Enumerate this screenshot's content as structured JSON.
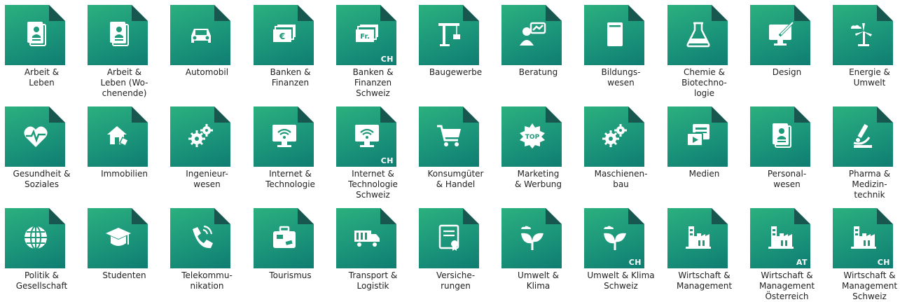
{
  "tiles": [
    {
      "label": "Arbeit &\nLeben",
      "icon": "id-card-icon",
      "cc": ""
    },
    {
      "label": "Arbeit &\nLeben (Wo-\nchenende)",
      "icon": "id-card-icon",
      "cc": ""
    },
    {
      "label": "Automobil",
      "icon": "car-icon",
      "cc": ""
    },
    {
      "label": "Banken &\nFinanzen",
      "icon": "euro-banknotes-icon",
      "cc": ""
    },
    {
      "label": "Banken &\nFinanzen\nSchweiz",
      "icon": "franc-banknotes-icon",
      "cc": "CH"
    },
    {
      "label": "Baugewerbe",
      "icon": "crane-icon",
      "cc": ""
    },
    {
      "label": "Beratung",
      "icon": "consultant-icon",
      "cc": ""
    },
    {
      "label": "Bildungs-\nwesen",
      "icon": "book-icon",
      "cc": ""
    },
    {
      "label": "Chemie &\nBiotechno-\nlogie",
      "icon": "flask-icon",
      "cc": ""
    },
    {
      "label": "Design",
      "icon": "monitor-brush-icon",
      "cc": ""
    },
    {
      "label": "Energie &\nUmwelt",
      "icon": "wind-turbine-icon",
      "cc": ""
    },
    {
      "label": "Gesundheit &\nSoziales",
      "icon": "heartbeat-icon",
      "cc": ""
    },
    {
      "label": "Immobilien",
      "icon": "house-tag-icon",
      "cc": ""
    },
    {
      "label": "Ingenieur-\nwesen",
      "icon": "gears-icon",
      "cc": ""
    },
    {
      "label": "Internet &\nTechnologie",
      "icon": "monitor-wifi-icon",
      "cc": ""
    },
    {
      "label": "Internet &\nTechnologie\nSchweiz",
      "icon": "monitor-wifi-icon",
      "cc": "CH"
    },
    {
      "label": "Konsumgüter\n& Handel",
      "icon": "shopping-cart-icon",
      "cc": ""
    },
    {
      "label": "Marketing\n& Werbung",
      "icon": "top-badge-icon",
      "cc": ""
    },
    {
      "label": "Maschienen-\nbau",
      "icon": "gears-icon",
      "cc": ""
    },
    {
      "label": "Medien",
      "icon": "media-icon",
      "cc": ""
    },
    {
      "label": "Personal-\nwesen",
      "icon": "id-card-icon",
      "cc": ""
    },
    {
      "label": "Pharma &\nMedizin-\ntechnik",
      "icon": "microscope-icon",
      "cc": ""
    },
    {
      "label": "Politik &\nGesellschaft",
      "icon": "globe-icon",
      "cc": ""
    },
    {
      "label": "Studenten",
      "icon": "graduation-cap-icon",
      "cc": ""
    },
    {
      "label": "Telekommu-\nnikation",
      "icon": "phone-icon",
      "cc": ""
    },
    {
      "label": "Tourismus",
      "icon": "suitcase-icon",
      "cc": ""
    },
    {
      "label": "Transport &\nLogistik",
      "icon": "truck-icon",
      "cc": ""
    },
    {
      "label": "Versiche-\nrungen",
      "icon": "certificate-icon",
      "cc": ""
    },
    {
      "label": "Umwelt &\nKlima",
      "icon": "plant-cloud-icon",
      "cc": ""
    },
    {
      "label": "Umwelt & Klima\nSchweiz",
      "icon": "plant-cloud-icon",
      "cc": "CH"
    },
    {
      "label": "Wirtschaft &\nManagement",
      "icon": "factory-icon",
      "cc": ""
    },
    {
      "label": "Wirtschaft &\nManagement\nÖsterreich",
      "icon": "factory-icon",
      "cc": "AT"
    },
    {
      "label": "Wirtschaft &\nManagement\nSchweiz",
      "icon": "factory-icon",
      "cc": "CH"
    }
  ],
  "colors": {
    "tile_top": "#2bb07e",
    "tile_bottom": "#0f7d72",
    "fold": "#17574f",
    "label": "#222222"
  },
  "icon_glyphs": {
    "euro": "€",
    "franc": "Fr.",
    "top": "TOP"
  }
}
